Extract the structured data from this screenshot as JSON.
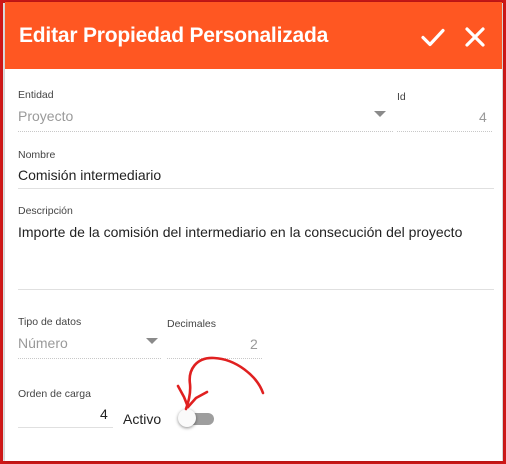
{
  "dialog": {
    "title": "Editar Propiedad Personalizada",
    "confirm_icon": "check-icon",
    "close_icon": "close-icon",
    "header_color": "#ff5722"
  },
  "fields": {
    "entidad": {
      "label": "Entidad",
      "value": "Proyecto"
    },
    "id": {
      "label": "Id",
      "value": "4"
    },
    "nombre": {
      "label": "Nombre",
      "value": "Comisión intermediario"
    },
    "descripcion": {
      "label": "Descripción",
      "value": "Importe de la comisión del intermediario en la consecución del proyecto"
    },
    "tipo_datos": {
      "label": "Tipo de datos",
      "value": "Número"
    },
    "decimales": {
      "label": "Decimales",
      "value": "2"
    },
    "orden_carga": {
      "label": "Orden de carga",
      "value": "4"
    },
    "activo": {
      "label": "Activo",
      "on": false
    }
  },
  "annotation": {
    "color": "#e02020",
    "icon": "hand-drawn-arrow-icon"
  }
}
